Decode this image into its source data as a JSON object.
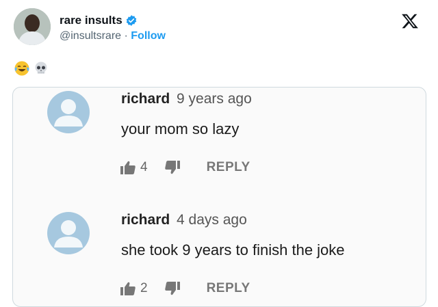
{
  "post": {
    "author_name": "rare insults",
    "handle": "@insultsrare",
    "separator": "·",
    "follow_label": "Follow",
    "emojis": [
      "face-with-tears-of-joy",
      "skull"
    ]
  },
  "comments": [
    {
      "author": "richard",
      "time": "9 years ago",
      "text": "your mom so lazy",
      "likes": "4",
      "reply_label": "REPLY"
    },
    {
      "author": "richard",
      "time": "4 days ago",
      "text": "she took 9 years to finish the joke",
      "likes": "2",
      "reply_label": "REPLY"
    }
  ],
  "colors": {
    "follow": "#1d9bf0",
    "verified": "#1d9bf0",
    "comment_avatar": "#a6c8df"
  }
}
